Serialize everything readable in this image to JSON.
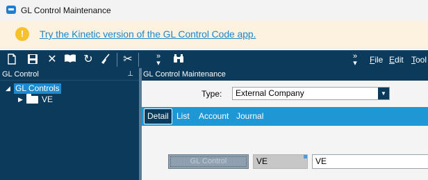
{
  "window": {
    "title": "GL Control Maintenance"
  },
  "banner": {
    "icon": "warning-icon",
    "icon_glyph": "!",
    "link_text": "Try the Kinetic version of the GL Control Code app."
  },
  "toolbar": {
    "icons": [
      "new-icon",
      "save-icon",
      "delete-icon",
      "book-icon",
      "refresh-icon",
      "clear-icon",
      "cut-icon",
      "binoculars-icon"
    ],
    "menus": [
      {
        "label": "File",
        "key": "F",
        "rest": "ile"
      },
      {
        "label": "Edit",
        "key": "E",
        "rest": "dit"
      },
      {
        "label": "Tools",
        "key": "T",
        "rest": "ool"
      }
    ]
  },
  "left_panel": {
    "header": "GL Control",
    "tree": {
      "root_label": "GL Controls",
      "child_label": "VE"
    }
  },
  "right_panel": {
    "header": "GL Control Maintenance",
    "type_label": "Type:",
    "type_value": "External Company",
    "tabs": [
      "Detail",
      "List",
      "Account",
      "Journal"
    ],
    "active_tab": "Detail",
    "gl_control_button": "GL Control",
    "code_readonly": "VE",
    "code_value": "VE"
  },
  "colors": {
    "toolbar_bg": "#0c3a5b",
    "tab_bar": "#1e97d4",
    "tree_selected": "#1a8ad2",
    "banner_bg": "#fdf2df",
    "link": "#1d86c9"
  }
}
